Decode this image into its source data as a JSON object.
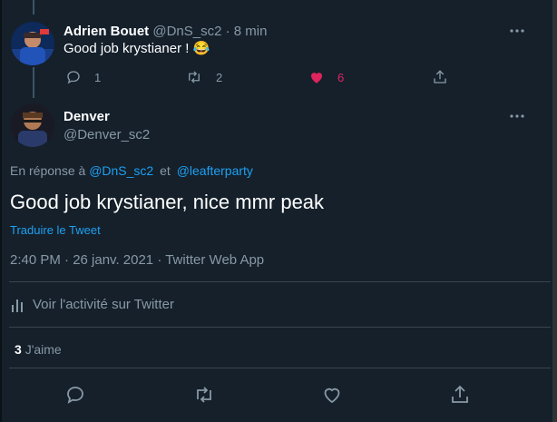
{
  "reply_tweet": {
    "author_name": "Adrien Bouet",
    "handle": "@DnS_sc2",
    "separator": "·",
    "time": "8 min",
    "text": "Good job krystianer !",
    "emoji": "😂",
    "reply_count": "1",
    "retweet_count": "2",
    "like_count": "6",
    "like_color": "#e0245e"
  },
  "main_tweet": {
    "author_name": "Denver",
    "handle": "@Denver_sc2",
    "reply_prefix": "En réponse à",
    "reply_to_1": "@DnS_sc2",
    "reply_joiner": "et",
    "reply_to_2": "@leafterparty",
    "text": "Good job krystianer, nice mmr peak",
    "translate_label": "Traduire le Tweet",
    "timestamp": "2:40 PM · 26 janv. 2021 · Twitter Web App",
    "activity_label": "Voir l'activité sur Twitter",
    "likes_count": "3",
    "likes_label": "J'aime"
  },
  "colors": {
    "background": "#15202b",
    "accent": "#1da1f2",
    "muted": "#8899a6",
    "divider": "#38444d"
  }
}
